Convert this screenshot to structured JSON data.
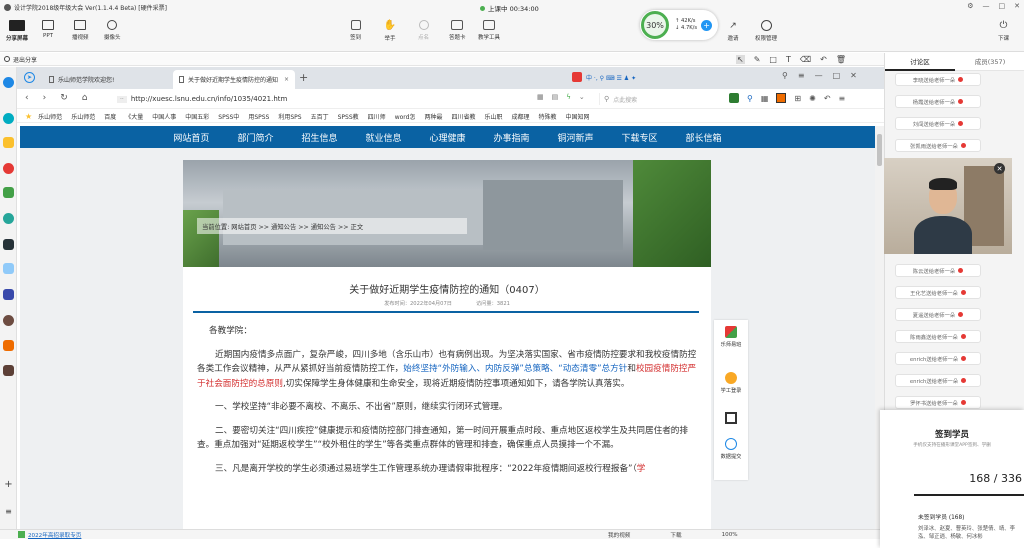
{
  "app": {
    "title": "设计学院2018级年级大会 Ver(1.1.4.4 Beta)  [硬件采票]",
    "live_status": "上课中 00:34:00"
  },
  "left_tools": [
    {
      "label": "分享屏幕",
      "icon": "screen-share-icon"
    },
    {
      "label": "PPT",
      "icon": "ppt-icon"
    },
    {
      "label": "播视频",
      "icon": "video-icon"
    },
    {
      "label": "摄像头",
      "icon": "camera-icon"
    }
  ],
  "center_tools": [
    {
      "label": "签到",
      "icon": "checkin-icon"
    },
    {
      "label": "举手",
      "icon": "hand-icon"
    },
    {
      "label": "点名",
      "icon": "rollcall-icon"
    },
    {
      "label": "答题卡",
      "icon": "answer-card-icon"
    },
    {
      "label": "教学工具",
      "icon": "teaching-tools-icon"
    }
  ],
  "net": {
    "percent": "30%",
    "up": "42K/s",
    "down": "4.7K/s"
  },
  "right_tools": [
    {
      "label": "邀请",
      "icon": "invite-icon"
    },
    {
      "label": "权限管理",
      "icon": "permission-icon"
    }
  ],
  "exit": {
    "label": "下课"
  },
  "share_bar": {
    "exit_label": "退出分享"
  },
  "browser": {
    "tabs": [
      {
        "title": "乐山师范学院欢迎您!"
      },
      {
        "title": "关于做好近期学生疫情防控的通知"
      }
    ],
    "url": "http://xuesc.lsnu.edu.cn/info/1035/4021.htm",
    "search_placeholder": "点此搜索",
    "bookmarks": [
      "乐山师范",
      "乐山师范",
      "百度",
      "《大量",
      "中国人事",
      "中国五彩",
      "SPSS中",
      "用SPSS",
      "利用SPS",
      "五百丁",
      "SPSS教",
      "四川师",
      "word怎",
      "两种最",
      "四川省教",
      "乐山职",
      "成都理",
      "特殊教",
      "中国知网"
    ],
    "statusbar": {
      "news": "2022年高招录取专页",
      "items": [
        "我的视频",
        "下载",
        "100%"
      ]
    }
  },
  "site": {
    "nav": [
      "网站首页",
      "部门简介",
      "招生信息",
      "就业信息",
      "心理健康",
      "办事指南",
      "铜河新声",
      "下载专区",
      "部长信箱"
    ],
    "breadcrumb": "当前位置: 网站首页 >> 通知公告 >> 通知公告 >> 正文",
    "article": {
      "title": "关于做好近期学生疫情防控的通知（0407）",
      "meta_date": "发布时间：2022年04月07日",
      "meta_views": "访问量：3821",
      "salutation": "各教学院：",
      "p1a": "近期国内疫情多点面广，复杂严峻，四川多地（含乐山市）也有病例出现。为坚决落实国家、省市疫情防控要求和我校疫情防控各类工作会议精神，从严从紧抓好当前疫情防控工作，",
      "p1b": "始终坚持“外防输入、内防反弹”总策略、“动态清零”总方针",
      "p1c": "和",
      "p1d": "校园疫情防控严于社会面防控的总原则",
      "p1e": ",切实保障学生身体健康和生命安全，现将近期疫情防控事项通知如下，请各学院认真落实。",
      "p2": "一、学校坚持“非必要不离校、不离乐、不出省”原则，继续实行闭环式管理。",
      "p3": "二、要密切关注“四川疾控”健康提示和疫情防控部门排查通知，第一时间开展重点时段、重点地区返校学生及共同居住者的排查。重点加强对“延期返校学生”“校外租住的学生”等各类重点群体的管理和排查，确保重点人员摸排一个不漏。",
      "p4a": "三、凡是离开学校的学生必须通过易班学生工作管理系统办理请假审批程序：“2022年疫情期间返校行程报备”（",
      "p4b": "学"
    },
    "side": [
      {
        "label": "乐师易班",
        "icon": "yiban-icon"
      },
      {
        "label": "学工登录",
        "icon": "login-icon"
      },
      {
        "label": "",
        "icon": "qrcode-icon"
      },
      {
        "label": "数据提交",
        "icon": "globe-icon"
      }
    ]
  },
  "chat": {
    "tabs": [
      "讨论区",
      "成员(357)"
    ],
    "messages_top": [
      "李晓送给老师一朵",
      "杨霞送给老师一朵",
      "刘闯送给老师一朵",
      "张凯雨送给老师一朵"
    ],
    "messages_bottom": [
      "陈云送给老师一朵",
      "王化艺送给老师一朵",
      "夏遥送给老师一朵",
      "陈雨鑫送给老师一朵",
      "enrich送给老师一朵",
      "enrich送给老师一朵",
      "罗怀书送给老师一朵"
    ]
  },
  "checkin": {
    "title": "签到学员",
    "subtitle": "手机仅支持在播形课堂APP签到、学删",
    "count": "168 / 336",
    "unsigned_label": "未签到学员 (168)",
    "names": "刘泽冰、赵夏、曹英玲、张楚倩、靖、李泓、邹正逍、杨敏、何冰彬"
  },
  "colors": {
    "nav_blue": "#0a62a3",
    "accent_green": "#4caf50",
    "flower_red": "#e53935"
  }
}
